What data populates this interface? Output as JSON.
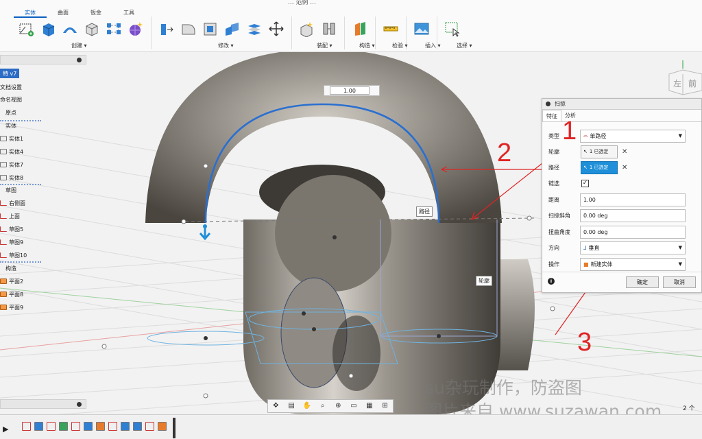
{
  "window": {
    "title": "... 范例 ..."
  },
  "toolbar": {
    "tabs": [
      "实体",
      "曲面",
      "钣金",
      "工具"
    ],
    "active_tab": "实体",
    "groups": [
      "创建 ▾",
      "修改 ▾",
      "装配 ▾",
      "构造 ▾",
      "检验 ▾",
      "插入 ▾",
      "选择 ▾"
    ]
  },
  "browser": {
    "header_top": "",
    "root_label": "特 v7",
    "items": [
      {
        "label": "文档设置",
        "icon": "gear"
      },
      {
        "label": "命名视图",
        "icon": "folder"
      },
      {
        "label": "原点",
        "icon": "folder"
      },
      {
        "label": "实体",
        "icon": "folder"
      },
      {
        "label": "实体1",
        "icon": "body"
      },
      {
        "label": "实体4",
        "icon": "body"
      },
      {
        "label": "实体7",
        "icon": "body"
      },
      {
        "label": "实体8",
        "icon": "body"
      },
      {
        "label": "草图",
        "icon": "folder"
      },
      {
        "label": "右侧面",
        "icon": "sketch"
      },
      {
        "label": "上面",
        "icon": "sketch"
      },
      {
        "label": "草图5",
        "icon": "sketch"
      },
      {
        "label": "草图9",
        "icon": "sketch"
      },
      {
        "label": "草图10",
        "icon": "sketch"
      },
      {
        "label": "构造",
        "icon": "folder"
      },
      {
        "label": "平面2",
        "icon": "plane"
      },
      {
        "label": "平面8",
        "icon": "plane"
      },
      {
        "label": "平面9",
        "icon": "plane"
      }
    ]
  },
  "viewport": {
    "distance_value": "1.00",
    "path_label": "路径",
    "profile_label": "轮廓",
    "viewcube_front": "前",
    "viewcube_left": "左"
  },
  "dialog": {
    "title": "扫掠",
    "tabs": [
      "特征",
      "分析"
    ],
    "type_label": "类型",
    "type_value": "单路径",
    "profile_label": "轮廓",
    "profile_value": "1 已选定",
    "path_label": "路径",
    "path_value": "1 已选定",
    "chain_label": "链选",
    "chain_checked": "✓",
    "distance_label": "距离",
    "distance_value": "1.00",
    "taper_label": "扫掠斜角",
    "taper_value": "0.00 deg",
    "twist_label": "扭曲角度",
    "twist_value": "0.00 deg",
    "orient_label": "方向",
    "orient_value": "垂直",
    "op_label": "操作",
    "op_value": "新建实体",
    "ok": "确定",
    "cancel": "取消"
  },
  "annotations": [
    "1",
    "2",
    "3"
  ],
  "watermark": [
    "su杂玩制作，防盗图",
    "图片来自 www.suzawan.com"
  ],
  "status": {
    "corner": "2 个 ..."
  },
  "colors": {
    "accent": "#1e8fd8",
    "annotation": "#e02323",
    "path_line": "#2a6fd0",
    "profile_line": "#7fb7e6"
  }
}
